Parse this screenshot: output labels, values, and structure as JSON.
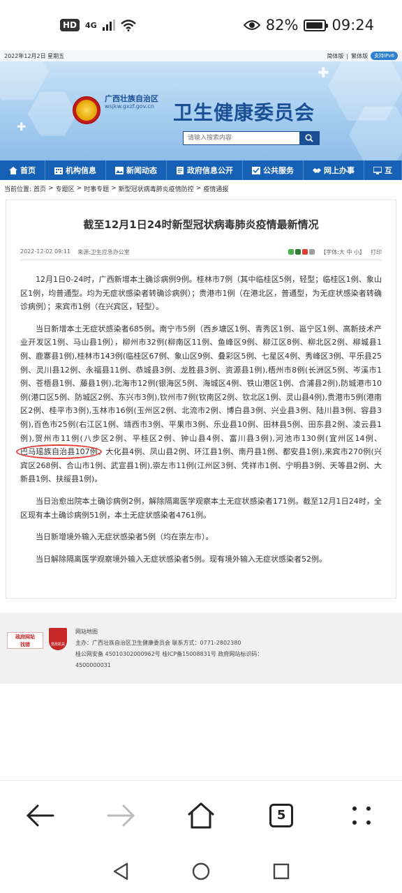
{
  "status_bar": {
    "hd": "HD",
    "signal": "4G",
    "battery": "82%",
    "battery_level": 0.82,
    "time": "09:24"
  },
  "top_bar": {
    "date": "2022年12月2日 星期五",
    "simplified": "简体版",
    "traditional": "繁体版",
    "ipv6": "支持IPv6"
  },
  "header": {
    "region_name": "广西壮族自治区",
    "site_domain": "wsjkw.gxzf.gov.cn",
    "org_name": "卫生健康委员会",
    "search_placeholder": "请输入搜索内容"
  },
  "nav": {
    "items": [
      {
        "label": "首页",
        "icon": "home-icon"
      },
      {
        "label": "机构信息",
        "icon": "org-icon"
      },
      {
        "label": "新闻动态",
        "icon": "news-icon"
      },
      {
        "label": "政府信息公开",
        "icon": "doc-icon"
      },
      {
        "label": "公共服务",
        "icon": "service-icon"
      },
      {
        "label": "网上办事",
        "icon": "handshake-icon"
      },
      {
        "label": "互",
        "icon": "monitor-icon"
      }
    ]
  },
  "breadcrumb": {
    "prefix": "当前位置:",
    "items": [
      "首页",
      "专题区",
      "时事专题",
      "新型冠状病毒肺炎疫情防控",
      "疫情通报"
    ],
    "separator": ">"
  },
  "article": {
    "title": "截至12月1日24时新型冠状病毒肺炎疫情最新情况",
    "date": "2022-12-02 09:11",
    "source": "来源:卫生应急办公室",
    "font_size": "【字体:大 中 小】",
    "print": "打印",
    "p1": "12月1日0-24时，广西新增本土确诊病例9例。桂林市7例（其中临桂区5例，轻型；临桂区1例、象山区1例，均普通型。均为无症状感染者转确诊病例）；贵港市1例（在港北区，普通型，为无症状感染者转确诊病例）；来宾市1例（在兴宾区，轻型）。",
    "p2_before": "当日新增本土无症状感染者685例。南宁市5例（西乡塘区1例、青秀区1例、邕宁区1例、高新技术产业开发区1例、马山县1例），柳州市32例(柳南区11例、鱼峰区9例、柳江区8例、柳北区2例、柳城县1例、鹿寨县1例),桂林市143例(临桂区67例、象山区9例、叠彩区5例、七星区4例、秀峰区3例、平乐县25例、灵川县12例、永福县11例、恭城县3例、龙胜县3例、资源县1例),梧州市8例(长洲区5例、岑溪市1例、苍梧县1例、藤县1例),北海市12例(银海区5例、海城区4例、铁山港区1例、合浦县2例),防城港市10例(港口区5例、防城区2例、东兴市3例),钦州市7例(钦南区2例、钦北区1例、灵山县4例),贵港市5例(港南区2例、桂平市3例),玉林市16例(玉州区2例、北流市2例、博白县3例、兴业县3例、陆川县3例、容县3例),百色市25例(右江区1例、靖西市3例、平果市3例、乐业县10例、田林县5例、田东县2例、凌云县1例),贺州市11例(八步区2例、平桂区2例、钟山县4例、富川县3例),河池市130例(宜州区14例、",
    "p2_highlight": "巴马瑶族自治县107例",
    "p2_after": "、大化县4例、凤山县2例、环江县1例、南丹县1例、都安县1例),来宾市270例(兴宾区268例、合山市1例、武宣县1例),崇左市11例(江州区3例、凭祥市1例、宁明县3例、天等县2例、大新县1例、扶绥县1例)。",
    "p3": "当日治愈出院本土确诊病例2例，解除隔离医学观察本土无症状感染者171例。截至12月1日24时，全区现有本土确诊病例51例，本土无症状感染者4761例。",
    "p4": "当日新增境外输入无症状感染者5例（均在崇左市）。",
    "p5": "当日解除隔离医学观察境外输入无症状感染者5例。现有境外输入无症状感染者52例。"
  },
  "footer": {
    "badge1_line1": "政府网站",
    "badge1_line2": "找错",
    "badge2": "党政机关",
    "sitemap": "网站地图",
    "host": "主办：广西壮族自治区卫生健康委员会   联系方式：0771-2802380",
    "icp": "桂公网安备 45010302000962号    桂ICP备15008831号    政府网站标识码：",
    "site_code": "4500000031"
  },
  "browser": {
    "tab_count": "5"
  }
}
